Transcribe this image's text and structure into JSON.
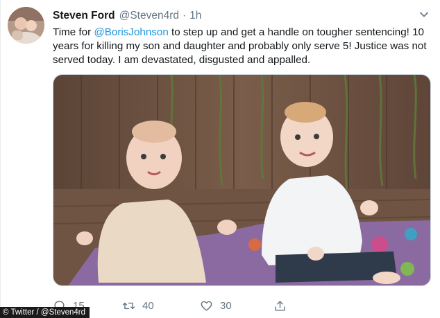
{
  "tweet": {
    "display_name": "Steven Ford",
    "handle": "@Steven4rd",
    "dot": "·",
    "time": "1h",
    "text_before": "Time for ",
    "mention": "@BorisJohnson",
    "text_after": " to step up and get a handle on tougher sentencing! 10 years for killing my son and daughter and probably only serve 5! Justice was not served today. I am devastated, disgusted and appalled."
  },
  "actions": {
    "reply_count": "15",
    "retweet_count": "40",
    "like_count": "30"
  },
  "icons": {
    "menu": "chevron-down-icon",
    "reply": "reply-icon",
    "retweet": "retweet-icon",
    "like": "heart-icon",
    "share": "share-icon"
  },
  "credit": "© Twitter / @Steven4rd",
  "colors": {
    "link": "#1b95e0",
    "secondary_text": "#657786",
    "primary_text": "#14171a"
  }
}
